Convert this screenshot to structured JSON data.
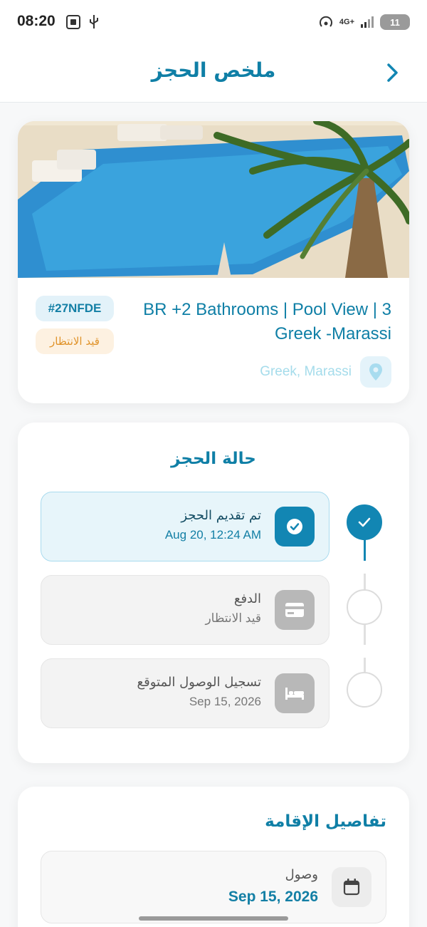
{
  "status_bar": {
    "time": "08:20",
    "network": "4G+",
    "battery": "11"
  },
  "header": {
    "title": "ملخص الحجز"
  },
  "listing": {
    "title": "BR +2 Bathrooms | Pool View | 3 Greek -Marassi",
    "reference": "#27NFDE",
    "status": "قيد الانتظار",
    "location": "Greek, Marassi"
  },
  "booking_status": {
    "title": "حالة الحجز",
    "steps": [
      {
        "title": "تم تقديم الحجز",
        "subtitle": "Aug 20, 12:24 AM"
      },
      {
        "title": "الدفع",
        "subtitle": "قيد الانتظار"
      },
      {
        "title": "تسجيل الوصول المتوقع",
        "subtitle": "Sep 15, 2026"
      }
    ]
  },
  "stay_details": {
    "title": "تفاصيل الإقامة",
    "checkin_label": "وصول",
    "checkin_date": "Sep 15, 2026"
  },
  "colors": {
    "accent": "#1286b3",
    "title": "#0f7fa6",
    "pending": "#e0932a"
  },
  "icons": [
    "back-chevron-icon",
    "location-pin-icon",
    "check-icon",
    "credit-card-icon",
    "bed-icon",
    "calendar-icon"
  ]
}
